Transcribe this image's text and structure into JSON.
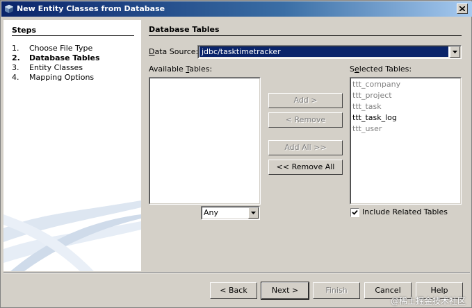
{
  "window": {
    "title": "New Entity Classes from Database",
    "close_icon": "close-icon"
  },
  "steps": {
    "title": "Steps",
    "items": [
      {
        "num": "1.",
        "label": "Choose File Type",
        "active": false
      },
      {
        "num": "2.",
        "label": "Database Tables",
        "active": true
      },
      {
        "num": "3.",
        "label": "Entity Classes",
        "active": false
      },
      {
        "num": "4.",
        "label": "Mapping Options",
        "active": false
      }
    ]
  },
  "main": {
    "title": "Database Tables",
    "data_source_label": "Data Source:",
    "data_source_value": "jdbc/tasktimetracker",
    "available_label": "Available Tables:",
    "selected_label": "Selected Tables:",
    "selected_tables": [
      {
        "name": "ttt_company",
        "enabled": false
      },
      {
        "name": "ttt_project",
        "enabled": false
      },
      {
        "name": "ttt_task",
        "enabled": false
      },
      {
        "name": "ttt_task_log",
        "enabled": true
      },
      {
        "name": "ttt_user",
        "enabled": false
      }
    ],
    "add_label": "Add >",
    "remove_label": "< Remove",
    "add_all_label": "Add All >>",
    "remove_all_label": "<< Remove All",
    "filter_value": "Any",
    "include_related_label": "Include Related Tables",
    "include_related_checked": true
  },
  "footer": {
    "back_label": "< Back",
    "next_label": "Next >",
    "finish_label": "Finish",
    "cancel_label": "Cancel",
    "help_label": "Help"
  },
  "watermark": "@稀土掘金技术社区"
}
